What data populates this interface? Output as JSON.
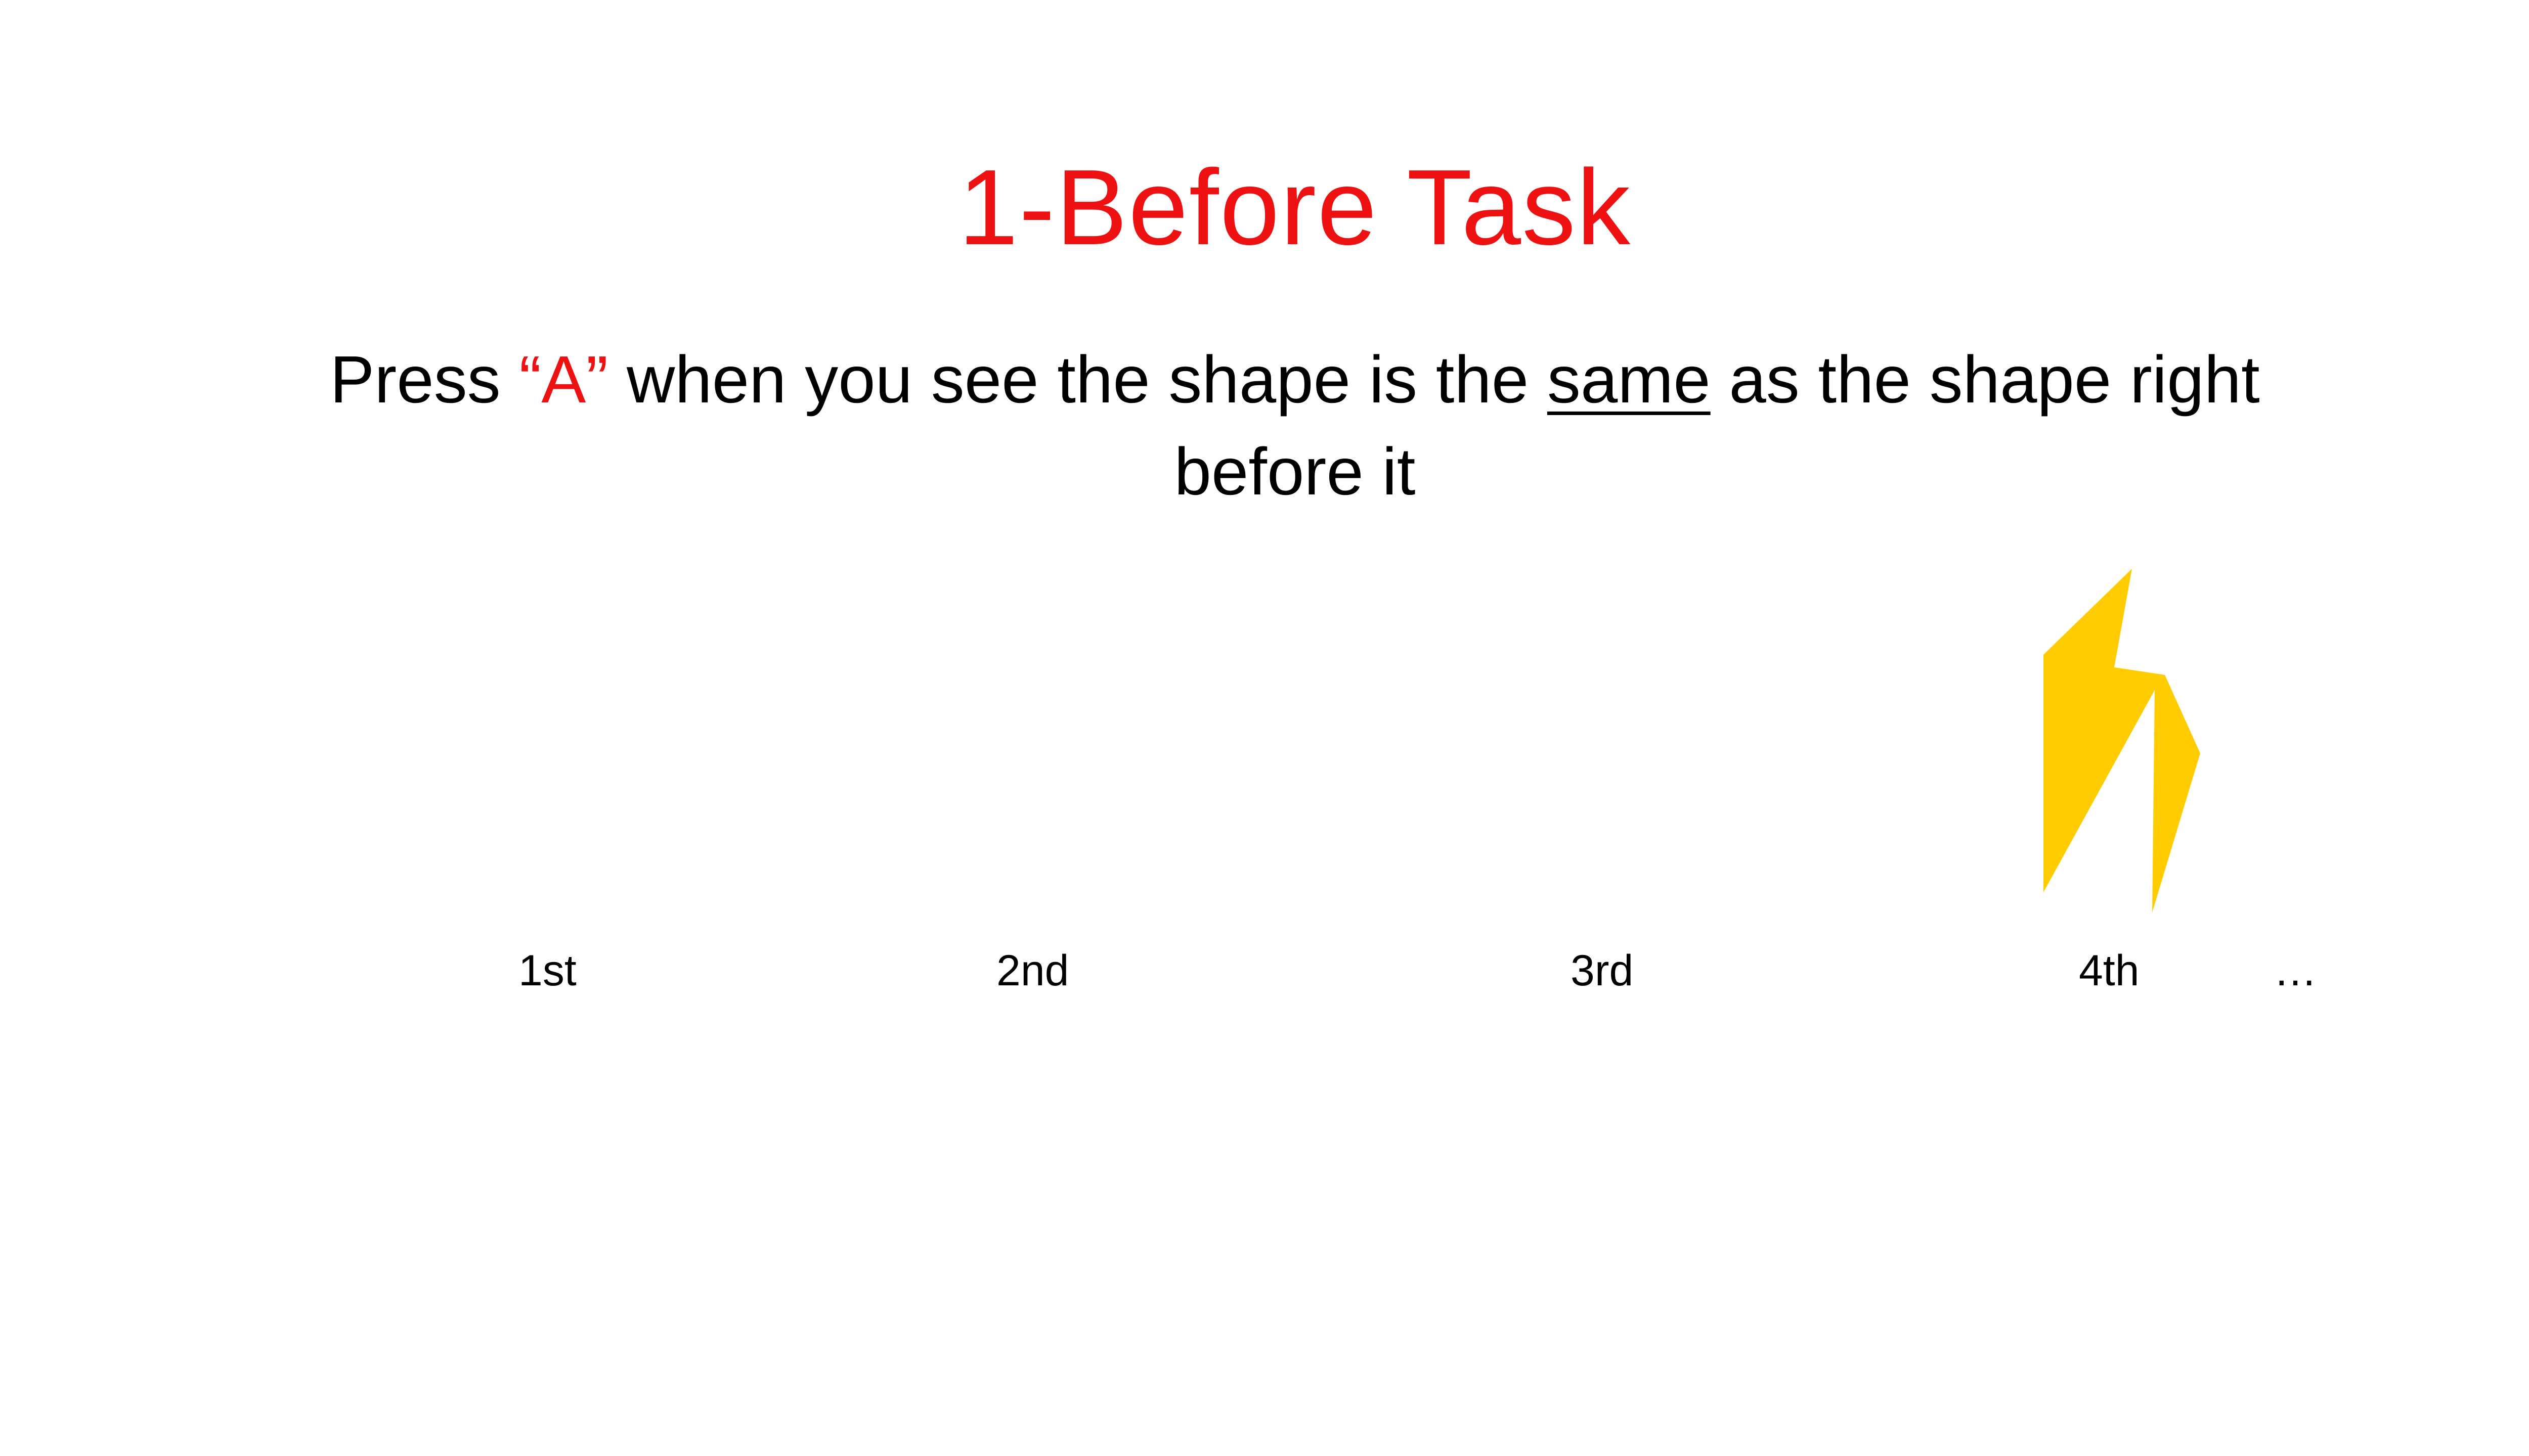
{
  "title": {
    "text": "1-Before Task",
    "color": "#ee1111"
  },
  "instruction": {
    "prefix": "Press ",
    "key": "“A”",
    "key_color": "#ee1111",
    "middle": " when you see the shape is the ",
    "emphasis": "same",
    "suffix": " as the shape right before it"
  },
  "sequence": {
    "labels": [
      "1st",
      "2nd",
      "3rd",
      "4th",
      "…"
    ],
    "shape": {
      "icon": "lightning-bolt-icon",
      "color": "#ffcc00",
      "shown_at": "4th"
    }
  }
}
